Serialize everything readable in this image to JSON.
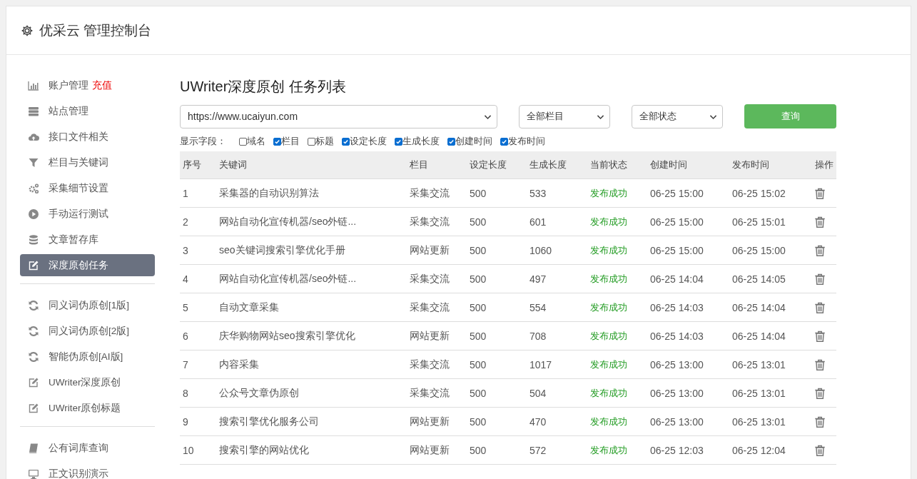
{
  "header": {
    "title": "优采云 管理控制台"
  },
  "sidebar": {
    "groups": [
      {
        "items": [
          {
            "kind": "chart",
            "label": "账户管理",
            "badge": "充值",
            "selected": false
          },
          {
            "kind": "server",
            "label": "站点管理",
            "selected": false
          },
          {
            "kind": "cloud",
            "label": "接口文件相关",
            "selected": false
          },
          {
            "kind": "filter",
            "label": "栏目与关键词",
            "selected": false
          },
          {
            "kind": "gears",
            "label": "采集细节设置",
            "selected": false
          },
          {
            "kind": "play",
            "label": "手动运行测试",
            "selected": false
          },
          {
            "kind": "database",
            "label": "文章暂存库",
            "selected": false
          },
          {
            "kind": "edit",
            "label": "深度原创任务",
            "selected": true
          }
        ]
      },
      {
        "items": [
          {
            "kind": "refresh",
            "label": "同义词伪原创[1版]",
            "selected": false
          },
          {
            "kind": "refresh",
            "label": "同义词伪原创[2版]",
            "selected": false
          },
          {
            "kind": "refresh",
            "label": "智能伪原创[AI版]",
            "selected": false
          },
          {
            "kind": "edit",
            "label": "UWriter深度原创",
            "selected": false
          },
          {
            "kind": "edit",
            "label": "UWriter原创标题",
            "selected": false
          }
        ]
      },
      {
        "items": [
          {
            "kind": "book",
            "label": "公有词库查询",
            "selected": false
          },
          {
            "kind": "monitor",
            "label": "正文识别演示",
            "selected": false
          }
        ]
      }
    ]
  },
  "main": {
    "title": "UWriter深度原创 任务列表",
    "filters": {
      "site": "https://www.ucaiyun.com",
      "column": "全部栏目",
      "status": "全部状态",
      "query_button": "查询"
    },
    "fields_label": "显示字段：",
    "fields": [
      {
        "label": "域名",
        "checked": false
      },
      {
        "label": "栏目",
        "checked": true
      },
      {
        "label": "标题",
        "checked": false
      },
      {
        "label": "设定长度",
        "checked": true
      },
      {
        "label": "生成长度",
        "checked": true
      },
      {
        "label": "创建时间",
        "checked": true
      },
      {
        "label": "发布时间",
        "checked": true
      }
    ],
    "table": {
      "columns": [
        "序号",
        "关键词",
        "栏目",
        "设定长度",
        "生成长度",
        "当前状态",
        "创建时间",
        "发布时间",
        "操作"
      ],
      "rows": [
        {
          "no": "1",
          "keyword": "采集器的自动识别算法",
          "column": "采集交流",
          "set_length": "500",
          "gen_length": "533",
          "status": "发布成功",
          "created": "06-25 15:00",
          "published": "06-25 15:02"
        },
        {
          "no": "2",
          "keyword": "网站自动化宣传机器/seo外链...",
          "column": "采集交流",
          "set_length": "500",
          "gen_length": "601",
          "status": "发布成功",
          "created": "06-25 15:00",
          "published": "06-25 15:01"
        },
        {
          "no": "3",
          "keyword": "seo关键词搜索引擎优化手册",
          "column": "网站更新",
          "set_length": "500",
          "gen_length": "1060",
          "status": "发布成功",
          "created": "06-25 15:00",
          "published": "06-25 15:00"
        },
        {
          "no": "4",
          "keyword": "网站自动化宣传机器/seo外链...",
          "column": "采集交流",
          "set_length": "500",
          "gen_length": "497",
          "status": "发布成功",
          "created": "06-25 14:04",
          "published": "06-25 14:05"
        },
        {
          "no": "5",
          "keyword": "自动文章采集",
          "column": "采集交流",
          "set_length": "500",
          "gen_length": "554",
          "status": "发布成功",
          "created": "06-25 14:03",
          "published": "06-25 14:04"
        },
        {
          "no": "6",
          "keyword": "庆华购物网站seo搜索引擎优化",
          "column": "网站更新",
          "set_length": "500",
          "gen_length": "708",
          "status": "发布成功",
          "created": "06-25 14:03",
          "published": "06-25 14:04"
        },
        {
          "no": "7",
          "keyword": "内容采集",
          "column": "采集交流",
          "set_length": "500",
          "gen_length": "1017",
          "status": "发布成功",
          "created": "06-25 13:00",
          "published": "06-25 13:01"
        },
        {
          "no": "8",
          "keyword": "公众号文章伪原创",
          "column": "采集交流",
          "set_length": "500",
          "gen_length": "504",
          "status": "发布成功",
          "created": "06-25 13:00",
          "published": "06-25 13:01"
        },
        {
          "no": "9",
          "keyword": "搜索引擎优化服务公司",
          "column": "网站更新",
          "set_length": "500",
          "gen_length": "470",
          "status": "发布成功",
          "created": "06-25 13:00",
          "published": "06-25 13:01"
        },
        {
          "no": "10",
          "keyword": "搜索引擎的网站优化",
          "column": "网站更新",
          "set_length": "500",
          "gen_length": "572",
          "status": "发布成功",
          "created": "06-25 12:03",
          "published": "06-25 12:04"
        }
      ]
    }
  }
}
